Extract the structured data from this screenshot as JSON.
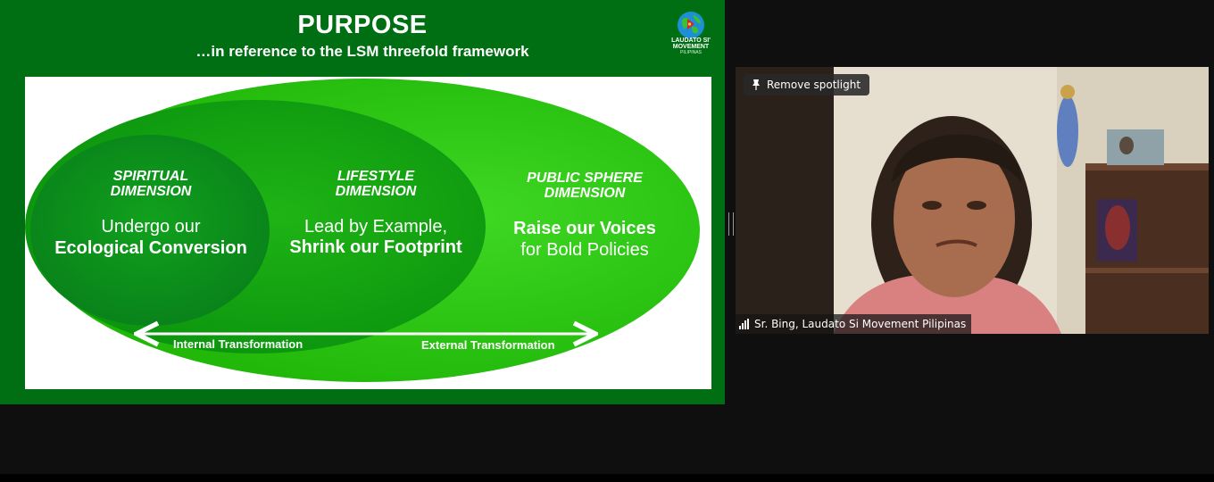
{
  "slide": {
    "title": "PURPOSE",
    "subtitle": "…in reference to the LSM threefold framework",
    "logo": {
      "line1": "LAUDATO SI'",
      "line2": "MOVEMENT",
      "line3": "PILIPINAS"
    },
    "dimensions": [
      {
        "heading_line1": "SPIRITUAL",
        "heading_line2": "DIMENSION",
        "text_line1": "Undergo our",
        "text_line2": "Ecological Conversion"
      },
      {
        "heading_line1": "LIFESTYLE",
        "heading_line2": "DIMENSION",
        "text_line1": "Lead by Example,",
        "text_line2": "Shrink our Footprint"
      },
      {
        "heading_line1": "PUBLIC SPHERE",
        "heading_line2": "DIMENSION",
        "text_line1": "Raise our Voices",
        "text_line2": "for Bold Policies"
      }
    ],
    "arrow_left_label": "Internal Transformation",
    "arrow_right_label": "External Transformation",
    "colors": {
      "background": "#006e12",
      "outer_ellipse": "#2ecc0e",
      "middle_ellipse": "#12a80f",
      "inner_ellipse": "#0a8f18"
    }
  },
  "video": {
    "spotlight_button": "Remove spotlight",
    "participant_name": "Sr. Bing, Laudato Si Movement  Pilipinas",
    "pin_icon": "pin-icon",
    "signal_icon": "signal-strength-icon"
  }
}
